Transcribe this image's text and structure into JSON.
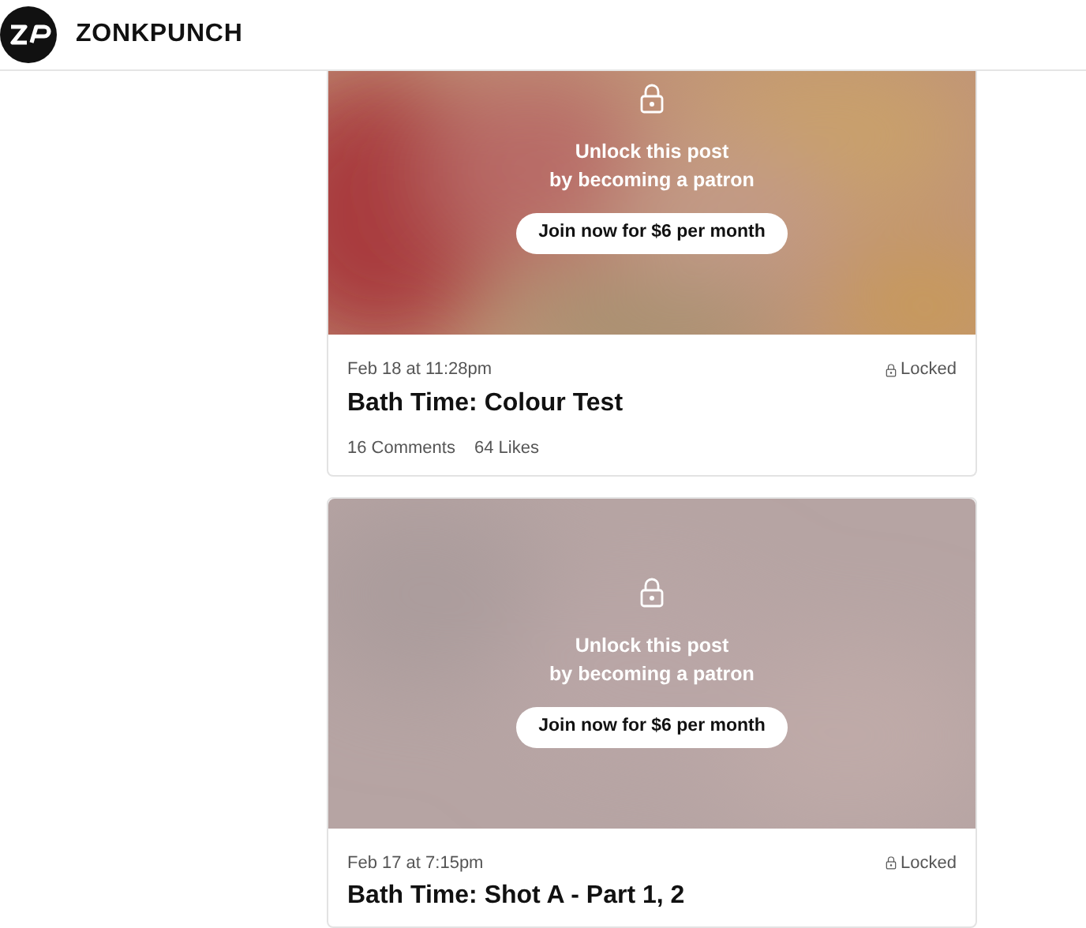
{
  "header": {
    "brand": "ZONKPUNCH"
  },
  "posts": [
    {
      "locked": true,
      "locked_message": "Unlock this post\nby becoming a patron",
      "join_button": "Join now for $6 per month",
      "date": "Feb 18 at 11:28pm",
      "status": "Locked",
      "title": "Bath Time: Colour Test",
      "comments": "16 Comments",
      "likes": "64 Likes"
    },
    {
      "locked": true,
      "locked_message": "Unlock this post\nby becoming a patron",
      "join_button": "Join now for $6 per month",
      "date": "Feb 17 at 7:15pm",
      "status": "Locked",
      "title": "Bath Time: Shot A - Part 1, 2"
    }
  ]
}
